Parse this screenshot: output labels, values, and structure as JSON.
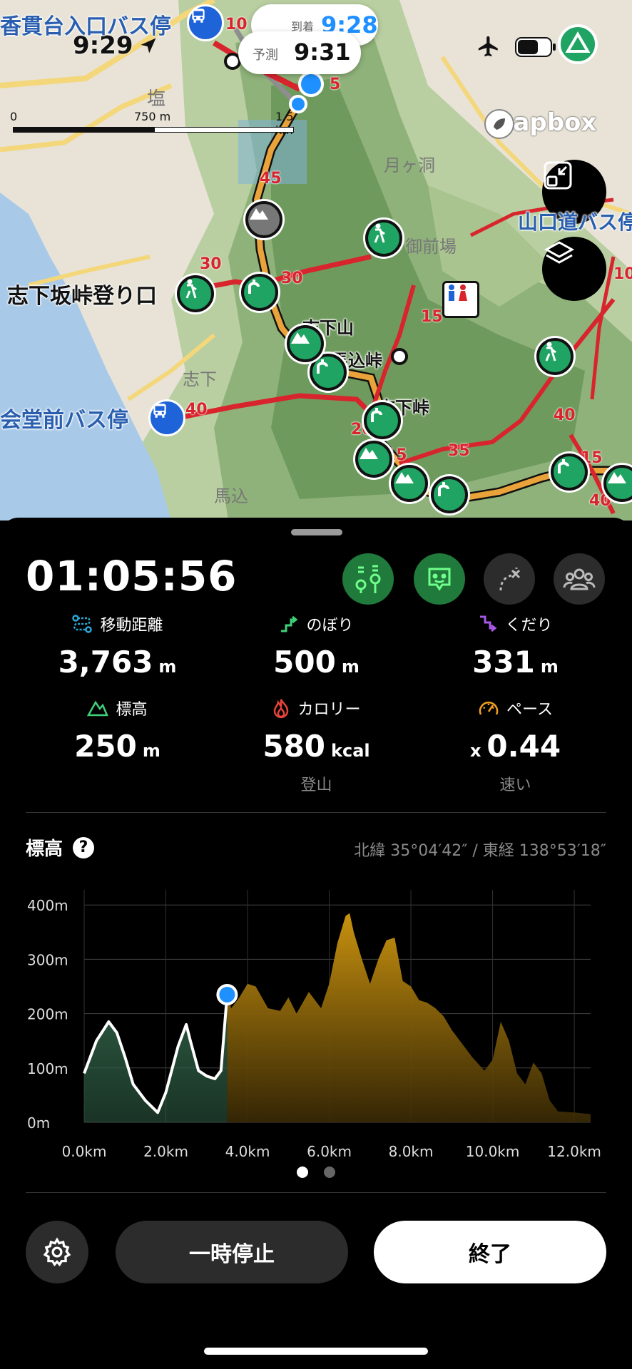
{
  "status_bar": {
    "time": "9:29"
  },
  "map": {
    "attribution": "mapbox",
    "scale": {
      "start": "0",
      "mid": "750 m",
      "end": "1.5 km"
    },
    "time_cards": {
      "arrival_label": "到着",
      "arrival_time": "9:28",
      "forecast_label": "予測",
      "forecast_time": "9:31"
    },
    "labels": {
      "bus_stop_top": "香貫台入口バス停",
      "trailhead": "志下坂峠登り口",
      "bus_stop_left": "会堂前バス停",
      "bus_stop_right": "山口道バス停",
      "peak_shimoyama": "志下山",
      "pass_magome": "馬込峠",
      "pass_shimo": "志下峠",
      "area_shio": "塩",
      "area_tsukigahora": "月ヶ洞",
      "area_mimae": "御前場",
      "area_shimo": "志下",
      "area_magome": "馬込"
    },
    "route_times": [
      "10",
      "5",
      "45",
      "30",
      "30",
      "35",
      "15",
      "40",
      "20",
      "15",
      "35",
      "15",
      "40",
      "40",
      "10"
    ]
  },
  "panel": {
    "elapsed": "01:05:56",
    "stats": [
      {
        "label": "移動距離",
        "value": "3,763",
        "unit": "m"
      },
      {
        "label": "のぼり",
        "value": "500",
        "unit": "m"
      },
      {
        "label": "くだり",
        "value": "331",
        "unit": "m"
      },
      {
        "label": "標高",
        "value": "250",
        "unit": "m"
      },
      {
        "label": "カロリー",
        "value": "580",
        "unit": "kcal",
        "sub": "登山"
      },
      {
        "label": "ペース",
        "prefix": "x",
        "value": "0.44",
        "sub": "速い"
      }
    ],
    "chart_title": "標高",
    "coordinates": "北緯 35°04′42″ / 東経 138°53′18″",
    "pause_label": "一時停止",
    "finish_label": "終了"
  },
  "colors": {
    "walked": "#2f5e45",
    "remaining": "#c9920f",
    "accent_green": "#1fa463",
    "current": "#1e90ff"
  },
  "chart_data": {
    "type": "area",
    "title": "標高",
    "xlabel": "",
    "ylabel": "",
    "x_ticks": [
      "0.0km",
      "2.0km",
      "4.0km",
      "6.0km",
      "8.0km",
      "10.0km",
      "12.0km"
    ],
    "y_ticks": [
      "0m",
      "100m",
      "200m",
      "300m",
      "400m"
    ],
    "xlim": [
      0,
      12.4
    ],
    "ylim": [
      0,
      420
    ],
    "current_km": 3.5,
    "x": [
      0,
      0.3,
      0.6,
      0.8,
      1.0,
      1.2,
      1.5,
      1.8,
      2.0,
      2.3,
      2.5,
      2.6,
      2.8,
      3.0,
      3.2,
      3.35,
      3.5,
      3.6,
      3.8,
      4.0,
      4.2,
      4.5,
      4.8,
      5.0,
      5.2,
      5.5,
      5.8,
      6.0,
      6.2,
      6.4,
      6.5,
      6.6,
      6.8,
      7.0,
      7.2,
      7.4,
      7.6,
      7.8,
      8.0,
      8.2,
      8.4,
      8.6,
      8.8,
      9.0,
      9.2,
      9.5,
      9.8,
      10.0,
      10.2,
      10.4,
      10.6,
      10.8,
      11.0,
      11.2,
      11.4,
      11.6,
      12.0,
      12.4
    ],
    "y": [
      90,
      150,
      185,
      165,
      120,
      70,
      40,
      18,
      55,
      140,
      180,
      150,
      95,
      85,
      80,
      95,
      235,
      210,
      230,
      255,
      250,
      210,
      205,
      230,
      200,
      240,
      210,
      255,
      330,
      380,
      385,
      350,
      300,
      255,
      300,
      335,
      340,
      260,
      250,
      225,
      220,
      210,
      195,
      170,
      150,
      120,
      95,
      115,
      185,
      150,
      90,
      70,
      110,
      90,
      40,
      20,
      18,
      15
    ]
  }
}
